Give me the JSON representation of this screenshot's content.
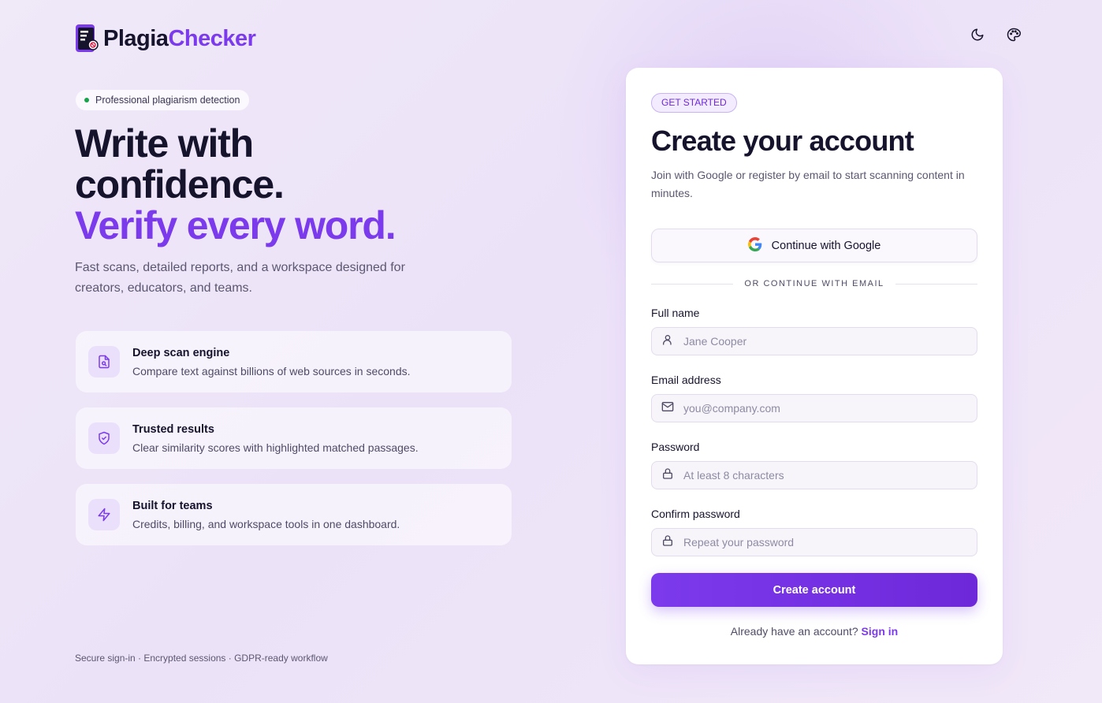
{
  "brand": {
    "name_part1": "Plagia",
    "name_part2": "Checker",
    "accent": "#7c3aed"
  },
  "header": {
    "icons": [
      "moon-icon",
      "palette-icon"
    ]
  },
  "hero": {
    "badge": "Professional plagiarism detection",
    "line1": "Write with",
    "line2": "confidence.",
    "line3": "Verify every word.",
    "subtitle": "Fast scans, detailed reports, and a workspace designed for creators, educators, and teams."
  },
  "features": [
    {
      "icon": "document-search-icon",
      "title": "Deep scan engine",
      "desc": "Compare text against billions of web sources in seconds."
    },
    {
      "icon": "shield-check-icon",
      "title": "Trusted results",
      "desc": "Clear similarity scores with highlighted matched passages."
    },
    {
      "icon": "lightning-icon",
      "title": "Built for teams",
      "desc": "Credits, billing, and workspace tools in one dashboard."
    }
  ],
  "footer_note": "Secure sign-in · Encrypted sessions · GDPR-ready workflow",
  "card": {
    "pill": "GET STARTED",
    "title": "Create your account",
    "subtitle": "Join with Google or register by email to start scanning content in minutes.",
    "google_label": "Continue with Google",
    "divider": "OR CONTINUE WITH EMAIL",
    "fields": {
      "name": {
        "label": "Full name",
        "placeholder": "Jane Cooper",
        "value": ""
      },
      "email": {
        "label": "Email address",
        "placeholder": "you@company.com",
        "value": ""
      },
      "password": {
        "label": "Password",
        "placeholder": "At least 8 characters",
        "value": ""
      },
      "confirm": {
        "label": "Confirm password",
        "placeholder": "Repeat your password",
        "value": ""
      }
    },
    "submit_label": "Create account",
    "signin_prompt": "Already have an account?",
    "signin_link": "Sign in"
  }
}
